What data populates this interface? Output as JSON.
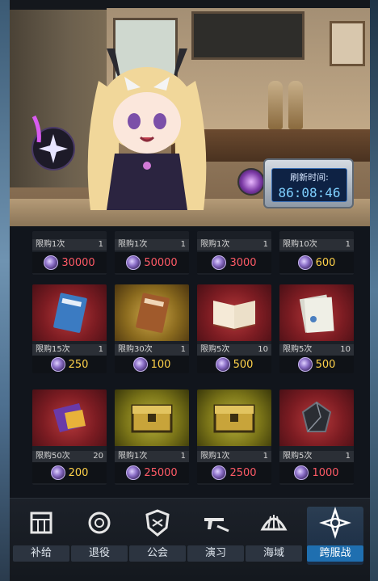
{
  "refresh": {
    "label": "刷新时间:",
    "countdown": "86:08:46"
  },
  "items": [
    {
      "limit": "限购1次",
      "stock": "1",
      "price": "30000",
      "price_color": "#ff5a66",
      "bg": "red"
    },
    {
      "limit": "限购1次",
      "stock": "1",
      "price": "50000",
      "price_color": "#ff5a66",
      "bg": "gold"
    },
    {
      "limit": "限购1次",
      "stock": "1",
      "price": "3000",
      "price_color": "#ff5a66",
      "bg": "olive"
    },
    {
      "limit": "限购10次",
      "stock": "1",
      "price": "600",
      "price_color": "#ffd24a",
      "bg": "red"
    },
    {
      "limit": "限购15次",
      "stock": "1",
      "price": "250",
      "price_color": "#ffd24a",
      "bg": "red",
      "icon": "blue-book-icon"
    },
    {
      "limit": "限购30次",
      "stock": "1",
      "price": "100",
      "price_color": "#ffd24a",
      "bg": "gold",
      "icon": "brown-book-icon"
    },
    {
      "limit": "限购5次",
      "stock": "10",
      "price": "500",
      "price_color": "#ffd24a",
      "bg": "red",
      "icon": "open-book-icon"
    },
    {
      "limit": "限购5次",
      "stock": "10",
      "price": "500",
      "price_color": "#ffd24a",
      "bg": "red",
      "icon": "logs-paper-icon"
    },
    {
      "limit": "限购50次",
      "stock": "20",
      "price": "200",
      "price_color": "#ffd24a",
      "bg": "red",
      "icon": "purple-parcel-icon"
    },
    {
      "limit": "限购1次",
      "stock": "1",
      "price": "25000",
      "price_color": "#ff5a66",
      "bg": "olive",
      "icon": "gold-chest-icon"
    },
    {
      "limit": "限购1次",
      "stock": "1",
      "price": "2500",
      "price_color": "#ff5a66",
      "bg": "olive",
      "icon": "gold-chest-icon"
    },
    {
      "limit": "限购5次",
      "stock": "1",
      "price": "1000",
      "price_color": "#ff5a66",
      "bg": "red",
      "icon": "dark-crystal-icon"
    }
  ],
  "tabs": [
    {
      "label": "补给",
      "icon": "supply-crate-icon"
    },
    {
      "label": "退役",
      "icon": "gear-flower-icon"
    },
    {
      "label": "公会",
      "icon": "guild-shield-icon"
    },
    {
      "label": "演习",
      "icon": "crossed-guns-icon"
    },
    {
      "label": "海域",
      "icon": "shell-icon"
    },
    {
      "label": "跨服战",
      "icon": "cross-server-emblem-icon",
      "active": true
    }
  ],
  "colors": {
    "accent_blue": "#1f6fb0",
    "price_red": "#ff5a66",
    "price_gold": "#ffd24a",
    "timer_text": "#7fd0ff"
  }
}
